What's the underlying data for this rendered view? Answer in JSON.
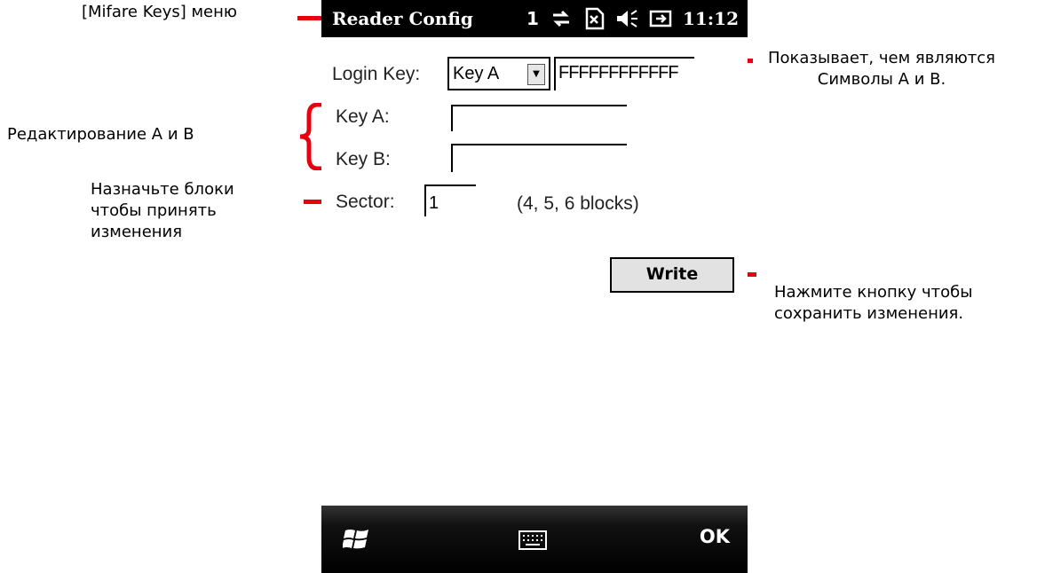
{
  "annotations": {
    "menu": "[Mifare Keys] меню",
    "shows_line1": "Показывает, чем являются",
    "shows_line2": "Символы А и В.",
    "edit": "Редактирование А и В",
    "assign_line1": "Назначьте блоки",
    "assign_line2": "чтобы принять",
    "assign_line3": "изменения",
    "press_line1": "Нажмите кнопку чтобы",
    "press_line2": "сохранить изменения."
  },
  "statusbar": {
    "title": "Reader Config",
    "icons": [
      "signal-1-icon",
      "data-arrows-icon",
      "no-sim-icon",
      "speaker-icon",
      "battery-plug-icon"
    ],
    "signal_text": "1",
    "time": "11:12"
  },
  "form": {
    "login_key_label": "Login Key:",
    "login_key_selected": "Key A",
    "login_key_value": "FFFFFFFFFFFF",
    "key_a_label": "Key A:",
    "key_a_value": "",
    "key_b_label": "Key B:",
    "key_b_value": "",
    "sector_label": "Sector:",
    "sector_value": "1",
    "sector_hint": "(4, 5, 6 blocks)",
    "write_label": "Write"
  },
  "bottombar": {
    "ok_label": "OK"
  },
  "colors": {
    "annotation_marker": "#e8000e",
    "statusbar_bg": "#000000",
    "button_bg": "#e2e2e2"
  }
}
